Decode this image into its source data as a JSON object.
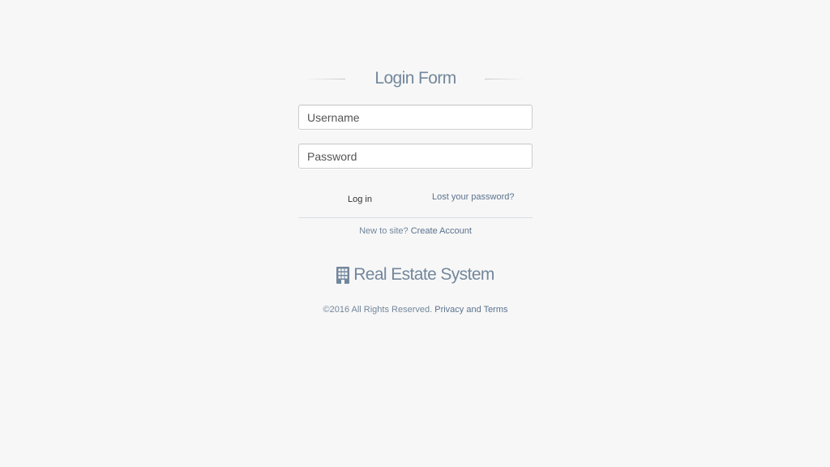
{
  "login": {
    "title": "Login Form",
    "username_placeholder": "Username",
    "password_placeholder": "Password",
    "username_value": "",
    "password_value": "",
    "login_label": "Log in",
    "lost_password_label": "Lost your password?",
    "signup_prompt": "New to site?",
    "create_account_label": "Create Account"
  },
  "brand": {
    "icon": "building-icon",
    "name": "Real Estate System"
  },
  "footer": {
    "copyright": "©2016 All Rights Reserved.",
    "privacy_terms_label": "Privacy and Terms"
  },
  "colors": {
    "background": "#f7f7f7",
    "text": "#73879c",
    "link": "#5a738e",
    "input_border": "#cccccc"
  }
}
